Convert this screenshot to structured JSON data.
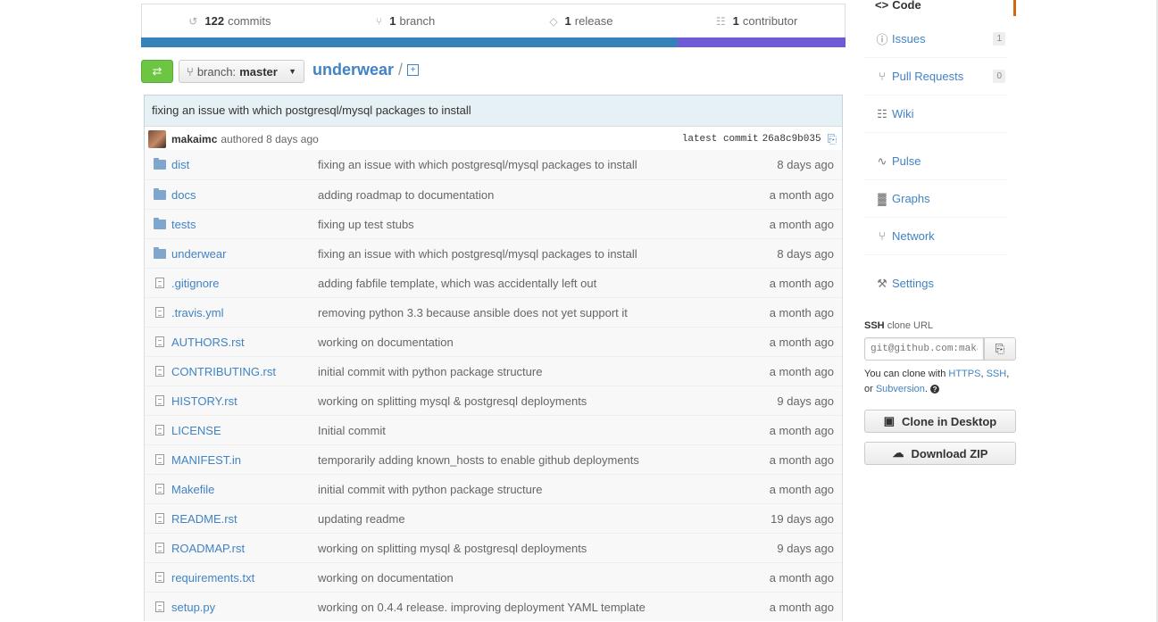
{
  "summary": {
    "commits": {
      "count": "122",
      "label": "commits"
    },
    "branches": {
      "count": "1",
      "label": "branch"
    },
    "releases": {
      "count": "1",
      "label": "release"
    },
    "contributors": {
      "count": "1",
      "label": "contributor"
    }
  },
  "language_bar": {
    "colors": [
      "#3581ba",
      "#6e5cd6"
    ],
    "fractions": [
      0.762,
      0.238
    ]
  },
  "branch": {
    "prefix": "branch:",
    "name": "master"
  },
  "breadcrumb": {
    "repo": "underwear",
    "separator": "/",
    "new_file_icon": "+"
  },
  "commit": {
    "message": "fixing an issue with which postgresql/mysql packages to install",
    "author": "makaimc",
    "authored": "authored 8 days ago",
    "latest_label": "latest commit",
    "sha": "26a8c9b035"
  },
  "files": [
    {
      "type": "folder",
      "name": "dist",
      "message": "fixing an issue with which postgresql/mysql packages to install",
      "age": "8 days ago"
    },
    {
      "type": "folder",
      "name": "docs",
      "message": "adding roadmap to documentation",
      "age": "a month ago"
    },
    {
      "type": "folder",
      "name": "tests",
      "message": "fixing up test stubs",
      "age": "a month ago"
    },
    {
      "type": "folder",
      "name": "underwear",
      "message": "fixing an issue with which postgresql/mysql packages to install",
      "age": "8 days ago"
    },
    {
      "type": "file",
      "name": ".gitignore",
      "message": "adding fabfile template, which was accidentally left out",
      "age": "a month ago"
    },
    {
      "type": "file",
      "name": ".travis.yml",
      "message": "removing python 3.3 because ansible does not yet support it",
      "age": "a month ago"
    },
    {
      "type": "file",
      "name": "AUTHORS.rst",
      "message": "working on documentation",
      "age": "a month ago"
    },
    {
      "type": "file",
      "name": "CONTRIBUTING.rst",
      "message": "initial commit with python package structure",
      "age": "a month ago"
    },
    {
      "type": "file",
      "name": "HISTORY.rst",
      "message": "working on splitting mysql & postgresql deployments",
      "age": "9 days ago"
    },
    {
      "type": "file",
      "name": "LICENSE",
      "message": "Initial commit",
      "age": "a month ago"
    },
    {
      "type": "file",
      "name": "MANIFEST.in",
      "message": "temporarily adding known_hosts to enable github deployments",
      "age": "a month ago"
    },
    {
      "type": "file",
      "name": "Makefile",
      "message": "initial commit with python package structure",
      "age": "a month ago"
    },
    {
      "type": "file",
      "name": "README.rst",
      "message": "updating readme",
      "age": "19 days ago"
    },
    {
      "type": "file",
      "name": "ROADMAP.rst",
      "message": "working on splitting mysql & postgresql deployments",
      "age": "9 days ago"
    },
    {
      "type": "file",
      "name": "requirements.txt",
      "message": "working on documentation",
      "age": "a month ago"
    },
    {
      "type": "file",
      "name": "setup.py",
      "message": "working on 0.4.4 release. improving deployment YAML template",
      "age": "a month ago"
    }
  ],
  "sidebar": {
    "code": "Code",
    "issues": {
      "label": "Issues",
      "count": "1"
    },
    "pulls": {
      "label": "Pull Requests",
      "count": "0"
    },
    "wiki": "Wiki",
    "pulse": "Pulse",
    "graphs": "Graphs",
    "network": "Network",
    "settings": "Settings",
    "accent_color": "#d26911"
  },
  "clone": {
    "protocol": "SSH",
    "label": "clone URL",
    "url": "git@github.com:makaimc/underwear.git",
    "help_prefix": "You can clone with",
    "https": "HTTPS",
    "ssh": "SSH",
    "or": "or",
    "subversion": "Subversion",
    "desktop_button": "Clone in Desktop",
    "zip_button": "Download ZIP"
  }
}
